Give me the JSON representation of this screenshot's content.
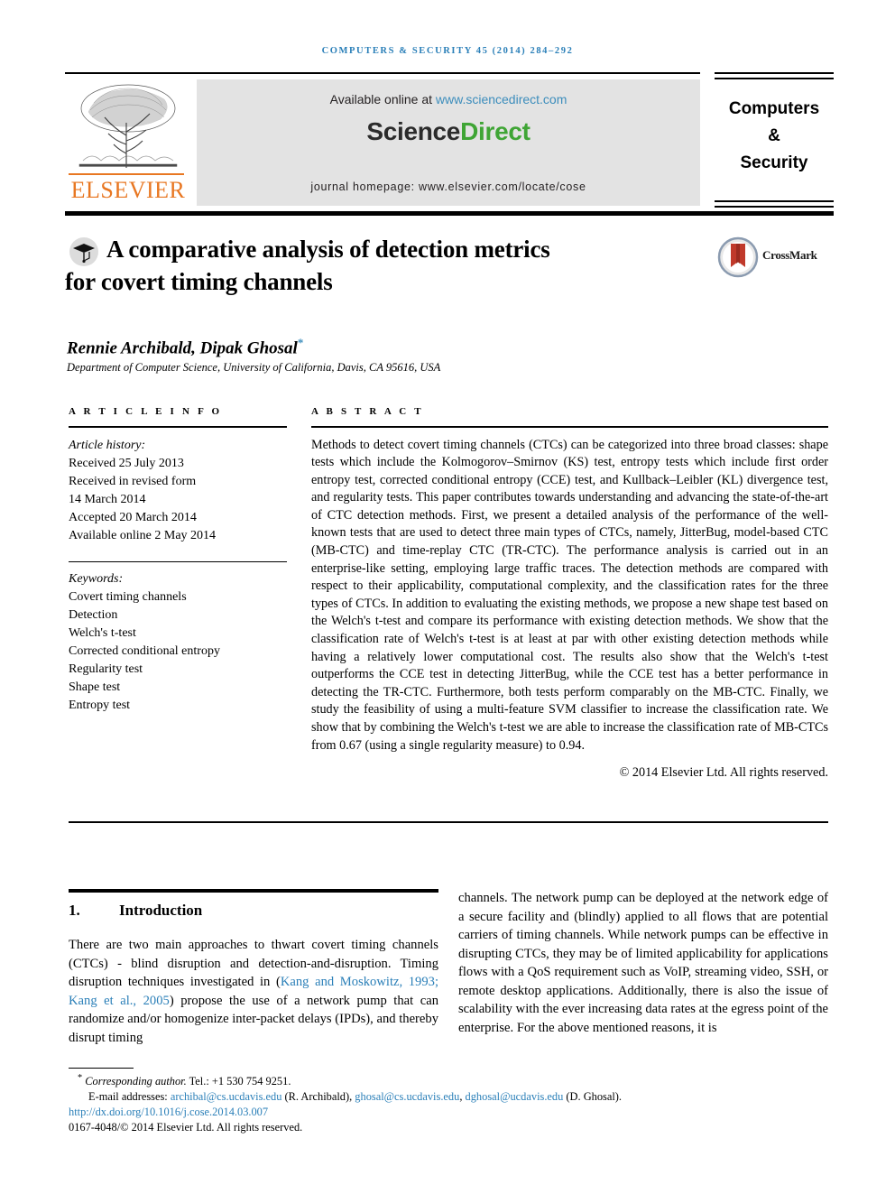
{
  "running_head": "COMPUTERS & SECURITY 45 (2014) 284–292",
  "masthead": {
    "publisher": "ELSEVIER",
    "available_text": "Available online at ",
    "available_link": "www.sciencedirect.com",
    "logo_part1": "Science",
    "logo_part2": "Direct",
    "homepage": "journal homepage: www.elsevier.com/locate/cose",
    "journal_title_lines": [
      "Computers",
      "&",
      "Security"
    ],
    "colors": {
      "elsevier_orange": "#E87722",
      "link_blue": "#3c8dbc",
      "direct_green": "#3fa535",
      "box_gray": "#e3e3e3"
    }
  },
  "title": {
    "line1": "A comparative analysis of detection metrics",
    "line2": "for covert timing channels",
    "crossmark_label": "CrossMark"
  },
  "authors": {
    "names": "Rennie Archibald, Dipak Ghosal",
    "corresponding_marker": "*",
    "affiliation": "Department of Computer Science, University of California, Davis, CA 95616, USA"
  },
  "article_info": {
    "heading": "A R T I C L E   I N F O",
    "history_label": "Article history:",
    "history": [
      "Received 25 July 2013",
      "Received in revised form",
      "14 March 2014",
      "Accepted 20 March 2014",
      "Available online 2 May 2014"
    ],
    "keywords_label": "Keywords:",
    "keywords": [
      "Covert timing channels",
      "Detection",
      "Welch's t-test",
      "Corrected conditional entropy",
      "Regularity test",
      "Shape test",
      "Entropy test"
    ]
  },
  "abstract": {
    "heading": "A B S T R A C T",
    "text": "Methods to detect covert timing channels (CTCs) can be categorized into three broad classes: shape tests which include the Kolmogorov–Smirnov (KS) test, entropy tests which include first order entropy test, corrected conditional entropy (CCE) test, and Kullback–Leibler (KL) divergence test, and regularity tests. This paper contributes towards understanding and advancing the state-of-the-art of CTC detection methods. First, we present a detailed analysis of the performance of the well-known tests that are used to detect three main types of CTCs, namely, JitterBug, model-based CTC (MB-CTC) and time-replay CTC (TR-CTC). The performance analysis is carried out in an enterprise-like setting, employing large traffic traces. The detection methods are compared with respect to their applicability, computational complexity, and the classification rates for the three types of CTCs. In addition to evaluating the existing methods, we propose a new shape test based on the Welch's t-test and compare its performance with existing detection methods. We show that the classification rate of Welch's t-test is at least at par with other existing detection methods while having a relatively lower computational cost. The results also show that the Welch's t-test outperforms the CCE test in detecting JitterBug, while the CCE test has a better performance in detecting the TR-CTC. Furthermore, both tests perform comparably on the MB-CTC. Finally, we study the feasibility of using a multi-feature SVM classifier to increase the classification rate. We show that by combining the Welch's t-test we are able to increase the classification rate of MB-CTCs from 0.67 (using a single regularity measure) to 0.94.",
    "copyright": "© 2014 Elsevier Ltd. All rights reserved."
  },
  "introduction": {
    "number": "1.",
    "heading": "Introduction",
    "left_text_a": "There are two main approaches to thwart covert timing channels (CTCs) - blind disruption and detection-and-disruption. Timing disruption techniques investigated in (",
    "citation": "Kang and Moskowitz, 1993; Kang et al., 2005",
    "left_text_b": ") propose the use of a network pump that can randomize and/or homogenize inter-packet delays (IPDs), and thereby disrupt timing",
    "right_text": "channels. The network pump can be deployed at the network edge of a secure facility and (blindly) applied to all flows that are potential carriers of timing channels. While network pumps can be effective in disrupting CTCs, they may be of limited applicability for applications flows with a QoS requirement such as VoIP, streaming video, SSH, or remote desktop applications. Additionally, there is also the issue of scalability with the ever increasing data rates at the egress point of the enterprise. For the above mentioned reasons, it is"
  },
  "footnotes": {
    "corresponding_marker": "*",
    "corresponding_label": "Corresponding author.",
    "tel": " Tel.: +1 530 754 9251.",
    "email_label": "E-mail addresses: ",
    "email1": "archibal@cs.ucdavis.edu",
    "email1_attr": " (R. Archibald), ",
    "email2": "ghosal@cs.ucdavis.edu",
    "email_sep": ", ",
    "email3": "dghosal@ucdavis.edu",
    "email3_attr": " (D. Ghosal).",
    "doi": "http://dx.doi.org/10.1016/j.cose.2014.03.007",
    "issn_line": "0167-4048/© 2014 Elsevier Ltd. All rights reserved."
  }
}
